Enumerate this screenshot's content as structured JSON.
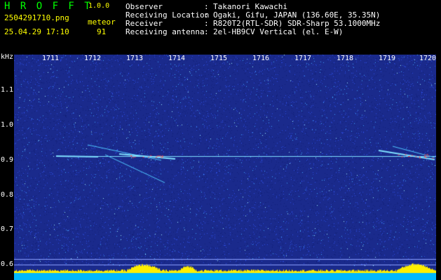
{
  "app": {
    "title": "H R O F F T",
    "version": "1.0.0",
    "filename": "2504291710.png",
    "datetime": "25.04.29 17:10",
    "mode_label": "meteor",
    "meteor_count": "91"
  },
  "info": [
    {
      "key": "Observer",
      "value": "Takanori Kawachi"
    },
    {
      "key": "Receiving Location",
      "value": "Ogaki, Gifu, JAPAN (136.60E, 35.35N)"
    },
    {
      "key": "Receiver",
      "value": "R820T2(RTL-SDR) SDR-Sharp 53.1000MHz"
    },
    {
      "key": "Receiving antenna",
      "value": "2el-HB9CV Vertical (el. E-W)"
    }
  ],
  "plot": {
    "unit": "kHz",
    "y_ticks": [
      "1.1",
      "1.0",
      "0.9",
      "0.8",
      "0.7",
      "0.6"
    ],
    "x_ticks": [
      "1711",
      "1712",
      "1713",
      "1714",
      "1715",
      "1716",
      "1717",
      "1718",
      "1719",
      "1720"
    ],
    "carrier_khz": 0.9,
    "y_range_khz": [
      0.57,
      1.17
    ],
    "colors": {
      "background": "#1a2a8c",
      "noise": "#2c4de0",
      "bright": "#7fe0ff",
      "hot": "#ff4040",
      "baseline": "#00e5ff",
      "level": "#ffee00"
    }
  }
}
